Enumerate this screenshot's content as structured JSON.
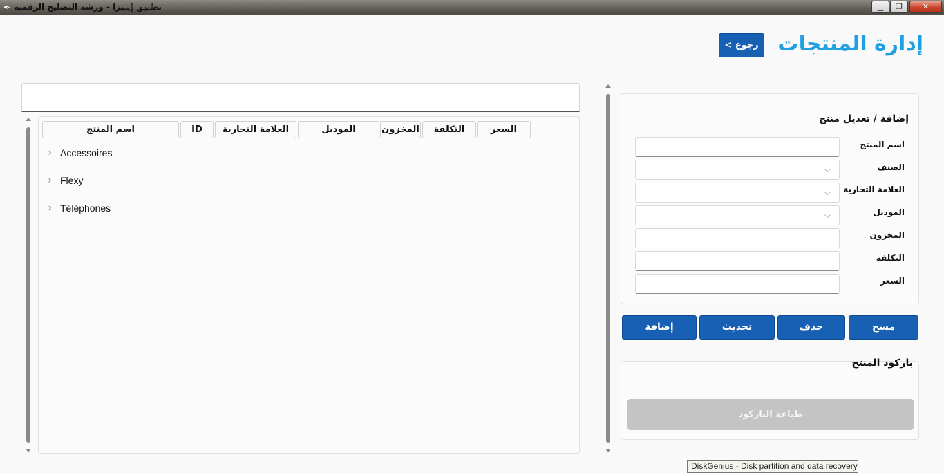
{
  "window": {
    "title": "تطبيق إيبيزا - ورشة التصليح الرقمية",
    "menu_ghost": "File    Edit    Tools    Select    Find    View    Window    Help",
    "minimize": "▁",
    "maximize": "❐",
    "close": "✕"
  },
  "header": {
    "title": "إدارة المنتجات",
    "back_label": "< رجوع"
  },
  "table": {
    "columns": [
      "السعر",
      "التكلفة",
      "المخزون",
      "الموديل",
      "العلامة التجارية",
      "ID",
      "اسم المنتج"
    ],
    "rows": [
      "Accessoires",
      "Flexy",
      "Téléphones"
    ],
    "chevron": "›"
  },
  "form": {
    "title": "إضافة / تعديل منتج",
    "fields": {
      "name": "اسم المنتج",
      "category": "الصنف",
      "brand": "العلامة التجارية",
      "model": "الموديل",
      "stock": "المخزون",
      "cost": "التكلفة",
      "price": "السعر"
    },
    "select_chevron": "⌵"
  },
  "actions": {
    "clear": "مسح",
    "delete": "حذف",
    "update": "تحديث",
    "add": "إضافة"
  },
  "barcode": {
    "title": "باركود المنتج",
    "print_label": "طباعة الباركود"
  },
  "tooltip": {
    "text": "DiskGenius - Disk partition and data recovery"
  }
}
